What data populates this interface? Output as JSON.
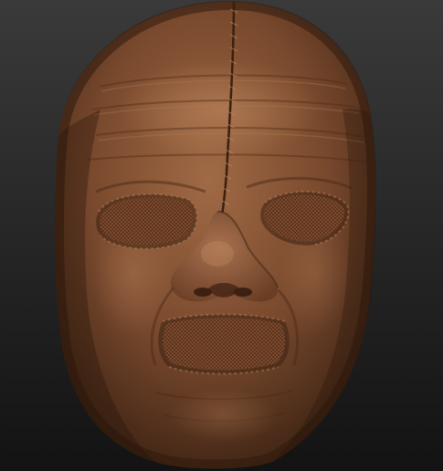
{
  "scene": {
    "subject": "sculpted-stitched-leather-mask",
    "background_colors": {
      "top": "#3a3a3a",
      "bottom": "#131313"
    },
    "material_colors": {
      "base": "#7a4a2e",
      "light": "#a06a45",
      "dark": "#3f2414",
      "highlight": "#c48c62"
    }
  }
}
